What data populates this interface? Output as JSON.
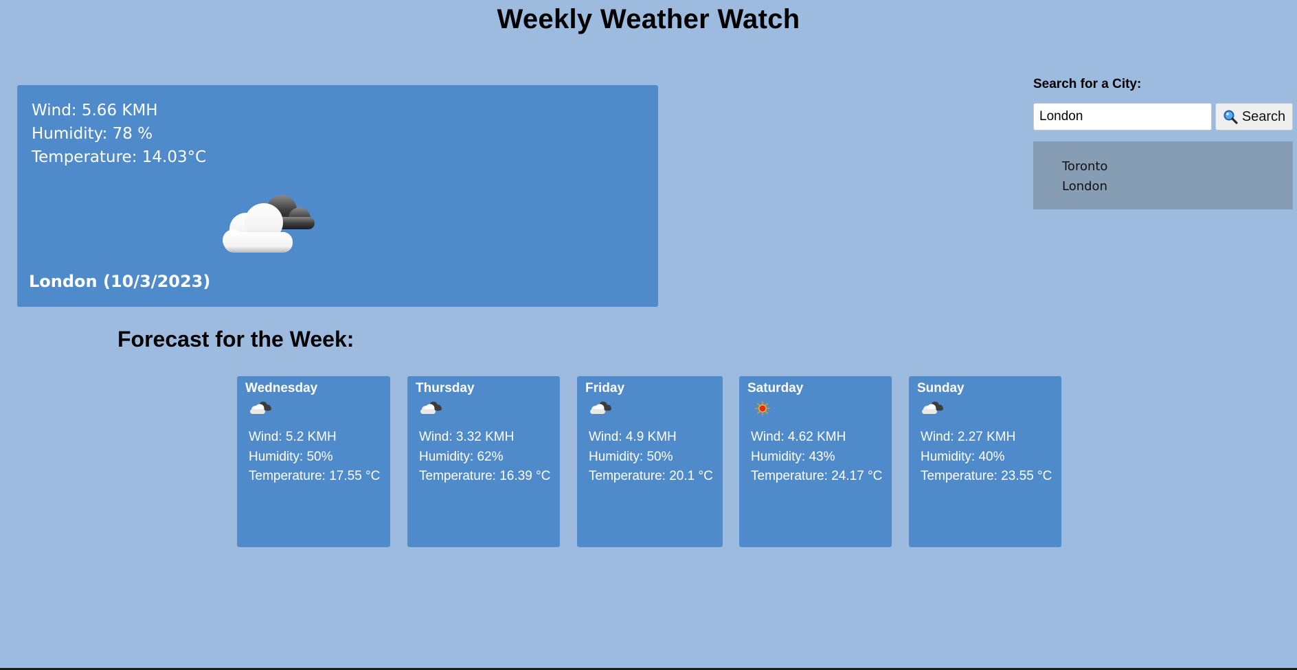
{
  "header": {
    "title": "Weekly Weather Watch"
  },
  "current": {
    "wind": "Wind: 5.66 KMH",
    "humidity": "Humidity: 78 %",
    "temperature": "Temperature: 14.03°C",
    "icon": "partly-cloudy-icon",
    "city_date": "London (10/3/2023)"
  },
  "search": {
    "label": "Search for a City:",
    "value": "London",
    "button_label": "Search",
    "button_icon": "magnifier-icon",
    "history": [
      "Toronto",
      "London"
    ]
  },
  "forecast": {
    "title": "Forecast for the Week:",
    "days": [
      {
        "day": "Wednesday",
        "icon": "cloudy-icon",
        "wind": "Wind: 5.2 KMH",
        "humidity": "Humidity: 50%",
        "temperature": "Temperature: 17.55 °C"
      },
      {
        "day": "Thursday",
        "icon": "cloudy-icon",
        "wind": "Wind: 3.32 KMH",
        "humidity": "Humidity: 62%",
        "temperature": "Temperature: 16.39 °C"
      },
      {
        "day": "Friday",
        "icon": "cloudy-icon",
        "wind": "Wind: 4.9 KMH",
        "humidity": "Humidity: 50%",
        "temperature": "Temperature: 20.1 °C"
      },
      {
        "day": "Saturday",
        "icon": "sun-icon",
        "wind": "Wind: 4.62 KMH",
        "humidity": "Humidity: 43%",
        "temperature": "Temperature: 24.17 °C"
      },
      {
        "day": "Sunday",
        "icon": "cloudy-icon",
        "wind": "Wind: 2.27 KMH",
        "humidity": "Humidity: 40%",
        "temperature": "Temperature: 23.55 °C"
      }
    ]
  },
  "colors": {
    "page_background": "#9dbadf",
    "card_background": "#4f8bca",
    "history_background": "#879db3"
  }
}
